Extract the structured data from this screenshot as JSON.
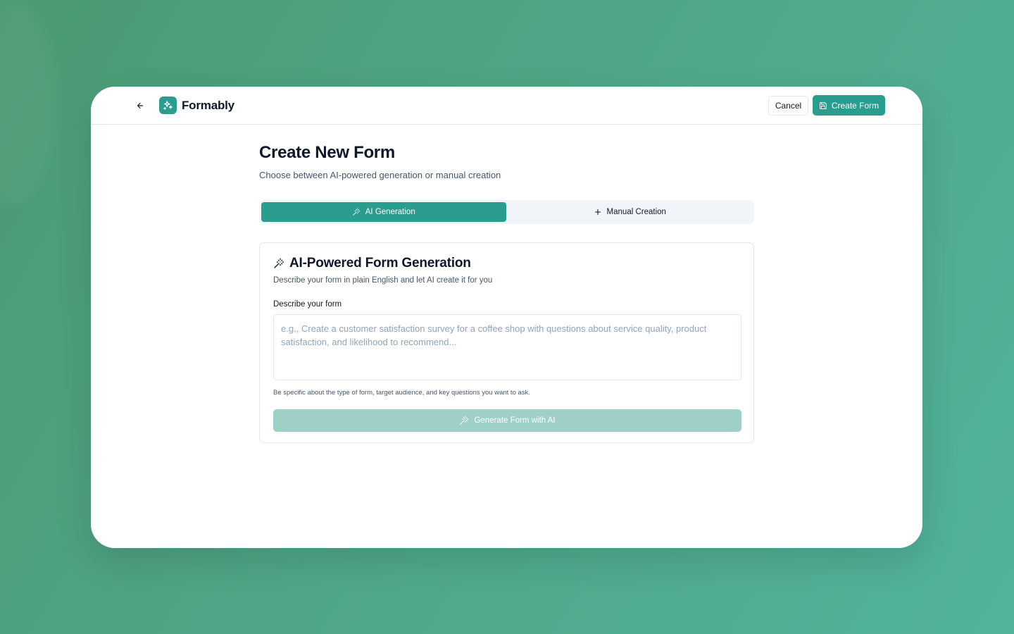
{
  "app": {
    "name": "Formably"
  },
  "header": {
    "cancel_label": "Cancel",
    "create_label": "Create Form"
  },
  "page": {
    "title": "Create New Form",
    "subtitle": "Choose between AI-powered generation or manual creation"
  },
  "tabs": [
    {
      "label": "AI Generation",
      "icon": "wand-icon",
      "active": true
    },
    {
      "label": "Manual Creation",
      "icon": "plus-icon",
      "active": false
    }
  ],
  "card": {
    "title": "AI-Powered Form Generation",
    "description": "Describe your form in plain English and let AI create it for you",
    "field_label": "Describe your form",
    "textarea_placeholder": "e.g., Create a customer satisfaction survey for a coffee shop with questions about service quality, product satisfaction, and likelihood to recommend...",
    "textarea_value": "",
    "hint": "Be specific about the type of form, target audience, and key questions you want to ask.",
    "generate_label": "Generate Form with AI"
  },
  "colors": {
    "accent": "#2a9d8f",
    "accent_disabled": "#9fd0c8",
    "background_start": "#4a9a72",
    "background_end": "#52b29c"
  }
}
